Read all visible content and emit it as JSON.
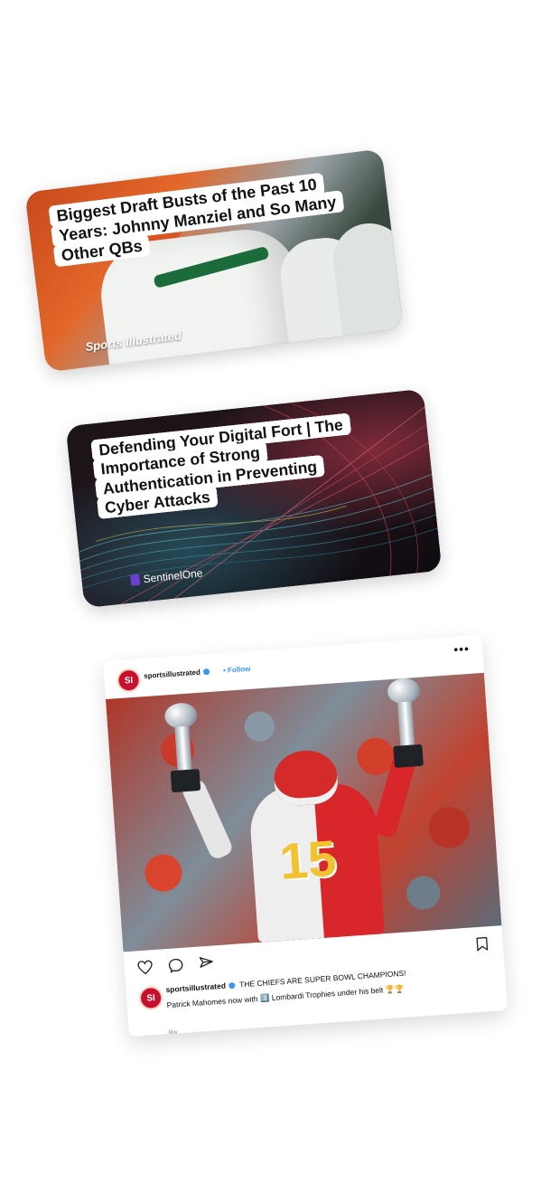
{
  "card1": {
    "headline": "Biggest Draft Busts of the Past 10 Years: Johnny Manziel and So Many Other QBs",
    "brand": "Sports Illustrated"
  },
  "card2": {
    "headline": "Defending Your Digital Fort | The Importance of Strong Authentication in Preventing Cyber Attacks",
    "brand": "SentinelOne"
  },
  "post": {
    "avatar_text": "SI",
    "handle": "sportsillustrated",
    "follow_label": "• Follow",
    "more_label": "•••",
    "caption_handle": "sportsillustrated",
    "caption_line1": "THE CHIEFS ARE SUPER BOWL CHAMPIONS!",
    "caption_line2": "Patrick Mahomes now with 3️⃣ Lombardi Trophies under his belt 🏆🏆",
    "time": "8w",
    "jersey_number": "15"
  },
  "colors": {
    "si_red": "#c8102e",
    "instagram_blue": "#3897f0",
    "chiefs_red": "#d9262a",
    "jets_green": "#1c6b3a"
  }
}
